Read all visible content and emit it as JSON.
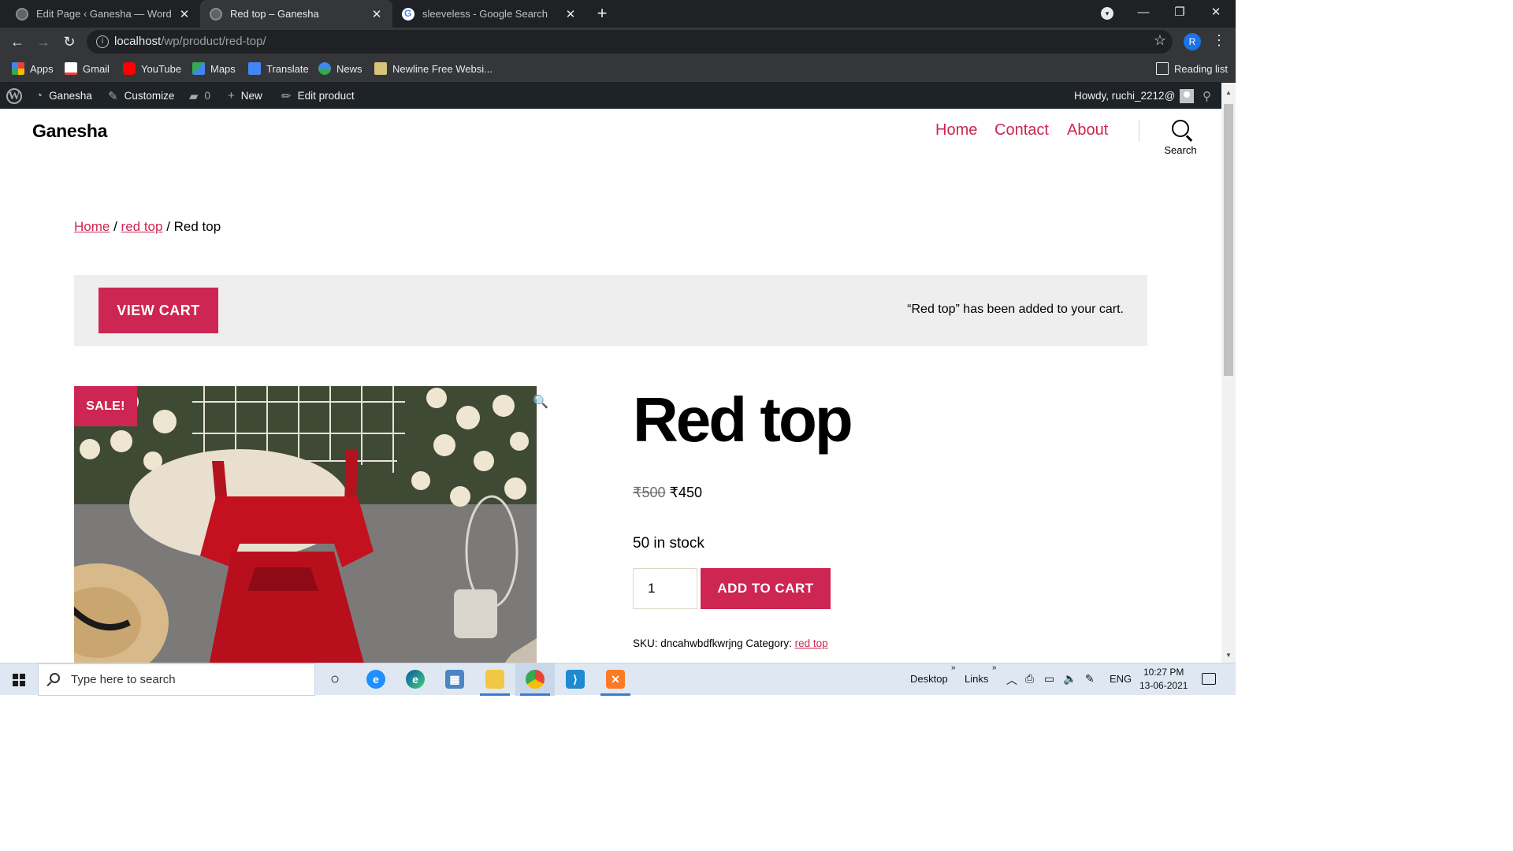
{
  "browser": {
    "tabs": [
      {
        "title": "Edit Page ‹ Ganesha — WordPress",
        "active": false
      },
      {
        "title": "Red top – Ganesha",
        "active": true
      },
      {
        "title": "sleeveless - Google Search",
        "active": false
      }
    ],
    "url_host": "localhost",
    "url_path": "/wp/product/red-top/",
    "profile_initial": "R",
    "bookmarks": [
      "Apps",
      "Gmail",
      "YouTube",
      "Maps",
      "Translate",
      "News",
      "Newline Free Websi..."
    ],
    "reading_list": "Reading list"
  },
  "admin_bar": {
    "site_name": "Ganesha",
    "customize": "Customize",
    "comments_count": "0",
    "new": "New",
    "edit_product": "Edit product",
    "howdy": "Howdy, ruchi_2212@"
  },
  "header": {
    "site_title": "Ganesha",
    "menu": [
      "Home",
      "Contact",
      "About"
    ],
    "search_label": "Search"
  },
  "breadcrumb": {
    "home": "Home",
    "category": "red top",
    "sep": " / ",
    "current": "Red top"
  },
  "notice": {
    "button": "VIEW CART",
    "message": "“Red top” has been added to your cart."
  },
  "product": {
    "sale_badge": "SALE!",
    "title": "Red top",
    "regular_price": "₹500",
    "sale_price": "₹450",
    "stock": "50 in stock",
    "quantity": "1",
    "add_to_cart": "ADD TO CART",
    "sku_label": "SKU:",
    "sku": "dncahwbdfkwrjng",
    "category_label": "Category:",
    "category": "red top"
  },
  "taskbar": {
    "search_placeholder": "Type here to search",
    "desktop": "Desktop",
    "links": "Links",
    "lang": "ENG",
    "time": "10:27 PM",
    "date": "13-06-2021"
  },
  "colors": {
    "accent": "#cd2653",
    "admin_bar": "#1d2327",
    "chrome_dark": "#202124"
  }
}
